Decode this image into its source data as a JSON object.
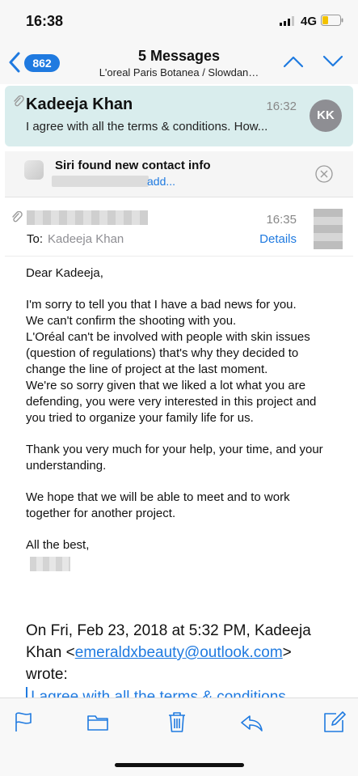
{
  "status_bar": {
    "time": "16:38",
    "network": "4G",
    "icons": [
      "signal-icon",
      "battery-icon"
    ]
  },
  "nav": {
    "unread_count": "862",
    "title": "5 Messages",
    "subtitle": "L'oreal Paris Botanea / Slowdan…",
    "icons": [
      "back-chevron-icon",
      "up-chevron-icon",
      "down-chevron-icon"
    ]
  },
  "thread": {
    "sender": "Kadeeja Khan",
    "time": "16:32",
    "preview": "I agree with all the terms & conditions. How...",
    "avatar_initials": "KK"
  },
  "siri_banner": {
    "title": "Siri found new contact info",
    "action": "add..."
  },
  "message": {
    "time": "16:35",
    "to_label": "To:",
    "to_name": "Kadeeja Khan",
    "details_label": "Details",
    "greeting": "Dear Kadeeja,",
    "paragraph1": [
      "I'm sorry to tell you that I have a bad news for you.",
      "We can't confirm the shooting with you.",
      "L'Oréal can't be involved with people with skin issues",
      "(question of regulations) that's why they decided to",
      "change the line of project at the last moment.",
      "We're so sorry given that we liked a lot what you are",
      "defending, you were very interested in this project and",
      "you tried to organize your family life for us."
    ],
    "paragraph2": [
      "Thank you very much for your help, your time, and your",
      "understanding."
    ],
    "paragraph3": [
      "We hope that we will be able to meet and to work",
      "together for another project."
    ],
    "closing": "All the best,"
  },
  "quote": {
    "prefix": "On Fri, Feb 23, 2018 at 5:32 PM, Kadeeja Khan <",
    "email": "emeraldxbeauty@outlook.com",
    "suffix": "> wrote:",
    "first_line": "I agree with all the terms & conditions."
  },
  "toolbar": {
    "icons": [
      "flag-icon",
      "folder-icon",
      "trash-icon",
      "reply-icon",
      "compose-icon"
    ]
  },
  "colors": {
    "accent": "#1f7ae0",
    "thread_highlight": "#d9eded",
    "bar_background": "#f7f7f7"
  }
}
